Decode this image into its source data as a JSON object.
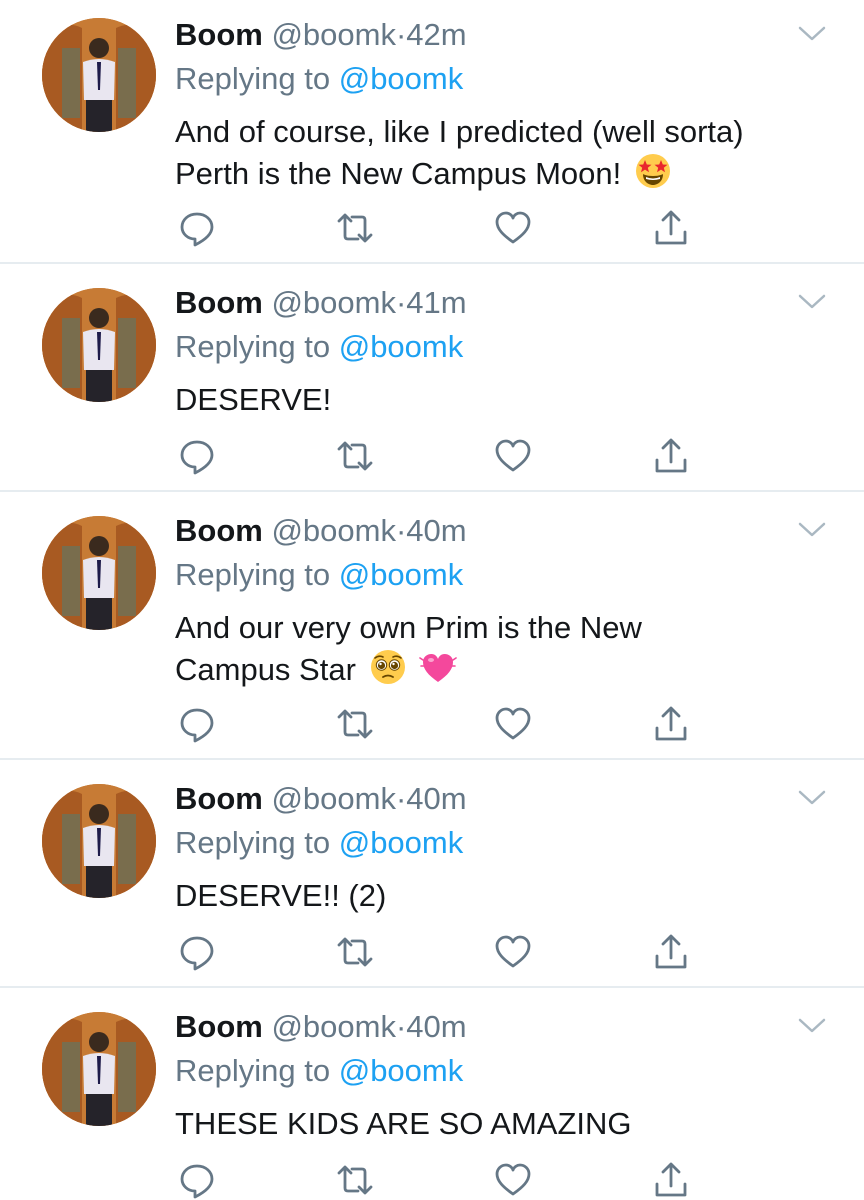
{
  "tweets": [
    {
      "name": "Boom",
      "handle": "@boomk",
      "separator": "·",
      "time": "42m",
      "replying_prefix": "Replying to",
      "replying_to": "@boomk",
      "text_lines": [
        "And of course, like I predicted (well sorta)",
        "Perth is the New Campus Moon!"
      ],
      "emojis": [
        "star-struck-emoji"
      ]
    },
    {
      "name": "Boom",
      "handle": "@boomk",
      "separator": "·",
      "time": "41m",
      "replying_prefix": "Replying to",
      "replying_to": "@boomk",
      "text_lines": [
        "DESERVE!"
      ],
      "emojis": []
    },
    {
      "name": "Boom",
      "handle": "@boomk",
      "separator": "·",
      "time": "40m",
      "replying_prefix": "Replying to",
      "replying_to": "@boomk",
      "text_lines": [
        "And our very own Prim is the New",
        "Campus Star"
      ],
      "emojis": [
        "pleading-face-emoji",
        "beating-heart-emoji"
      ]
    },
    {
      "name": "Boom",
      "handle": "@boomk",
      "separator": "·",
      "time": "40m",
      "replying_prefix": "Replying to",
      "replying_to": "@boomk",
      "text_lines": [
        "DESERVE!! (2)"
      ],
      "emojis": []
    },
    {
      "name": "Boom",
      "handle": "@boomk",
      "separator": "·",
      "time": "40m",
      "replying_prefix": "Replying to",
      "replying_to": "@boomk",
      "text_lines": [
        "THESE KIDS ARE SO AMAZING"
      ],
      "emojis": []
    }
  ],
  "icons": {
    "reply": "reply-icon",
    "retweet": "retweet-icon",
    "like": "heart-icon",
    "share": "share-icon",
    "menu": "chevron-down-icon"
  },
  "colors": {
    "text": "#14171a",
    "secondary": "#657786",
    "link": "#1da1f2",
    "divider": "#e6ecf0"
  }
}
